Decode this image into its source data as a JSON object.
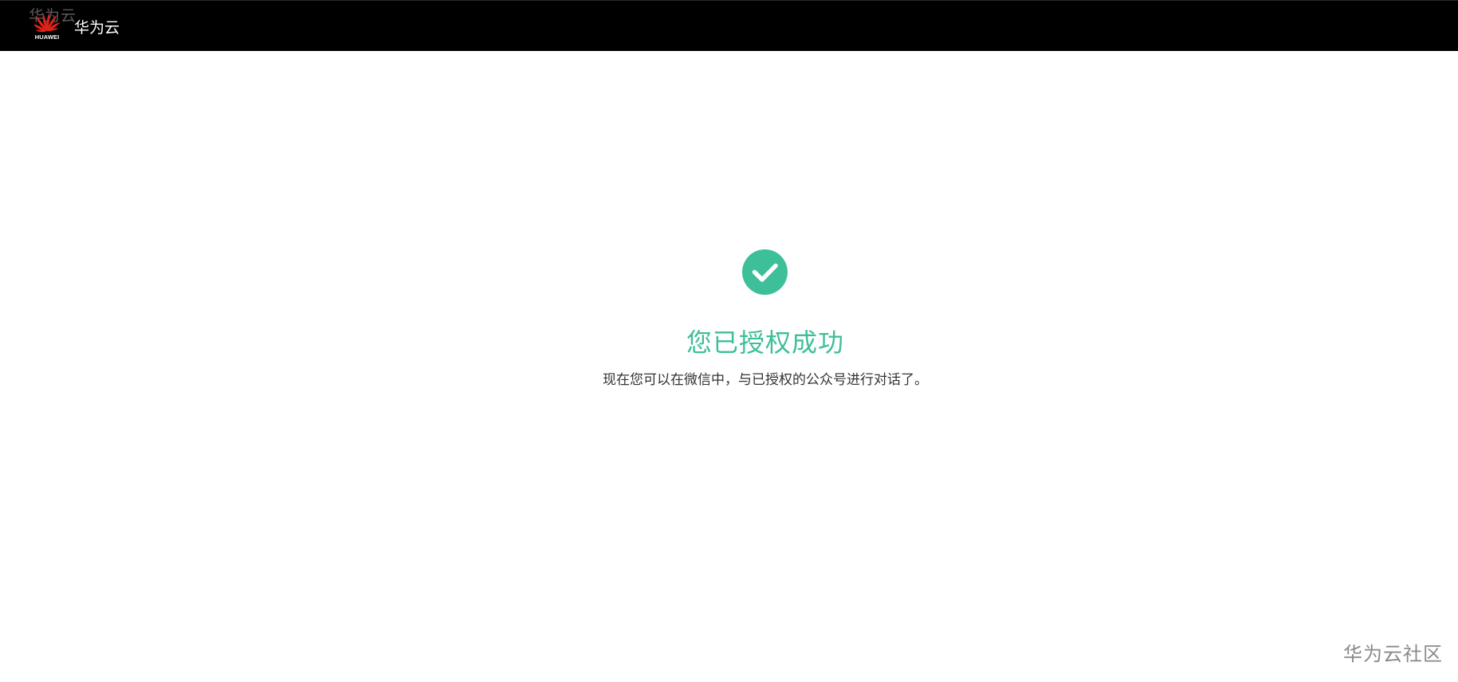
{
  "header": {
    "ghost_text": "华为云",
    "logo_caption": "HUAWEI",
    "brand_name": "华为云",
    "logo_icon": "huawei-petal-logo",
    "background_color": "#000000"
  },
  "result": {
    "icon": "check-circle-icon",
    "title": "您已授权成功",
    "description": "现在您可以在微信中，与已授权的公众号进行对话了。",
    "accent_color": "#3dbf9a"
  },
  "watermark": {
    "text": "华为云社区"
  }
}
